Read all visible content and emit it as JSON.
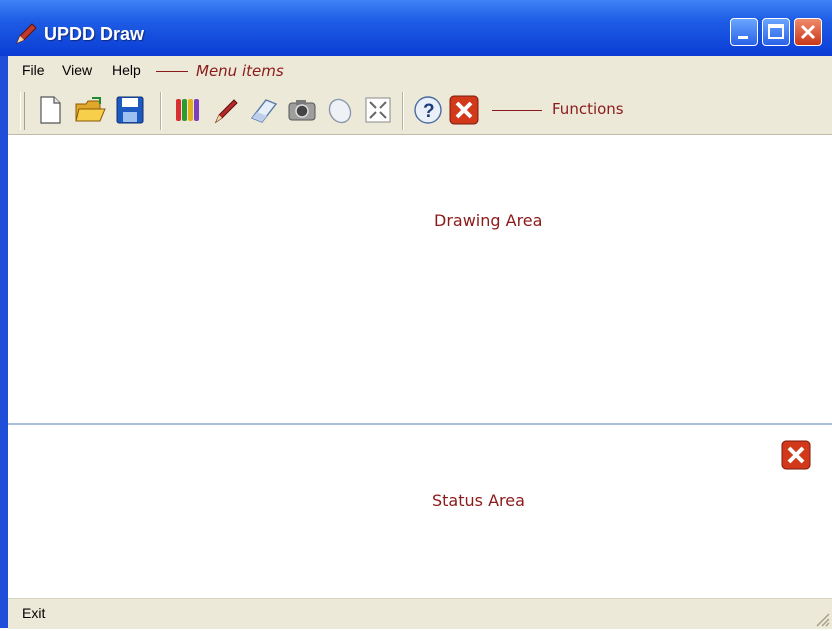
{
  "window": {
    "title": "UPDD Draw",
    "controls": [
      "minimize",
      "maximize",
      "close"
    ]
  },
  "menu": {
    "items": [
      {
        "label": "File"
      },
      {
        "label": "View"
      },
      {
        "label": "Help"
      }
    ],
    "annotation": "Menu items"
  },
  "toolbar": {
    "buttons": [
      {
        "icon": "new-document-icon"
      },
      {
        "icon": "open-folder-icon"
      },
      {
        "icon": "save-disk-icon"
      },
      {
        "icon": "colors-pencils-icon"
      },
      {
        "icon": "pen-icon"
      },
      {
        "icon": "eraser-icon"
      },
      {
        "icon": "camera-icon"
      },
      {
        "icon": "mouse-icon"
      },
      {
        "icon": "fullscreen-icon"
      },
      {
        "icon": "help-icon"
      },
      {
        "icon": "exit-icon"
      }
    ],
    "annotation": "Functions"
  },
  "drawing_area": {
    "label": "Drawing Area"
  },
  "status_area": {
    "label": "Status Area",
    "close_icon": "close-icon"
  },
  "statusbar": {
    "text": "Exit"
  },
  "colors": {
    "titlebar": "#0a3cd4",
    "annotation": "#8b1a1a",
    "close_red": "#d2381a"
  }
}
